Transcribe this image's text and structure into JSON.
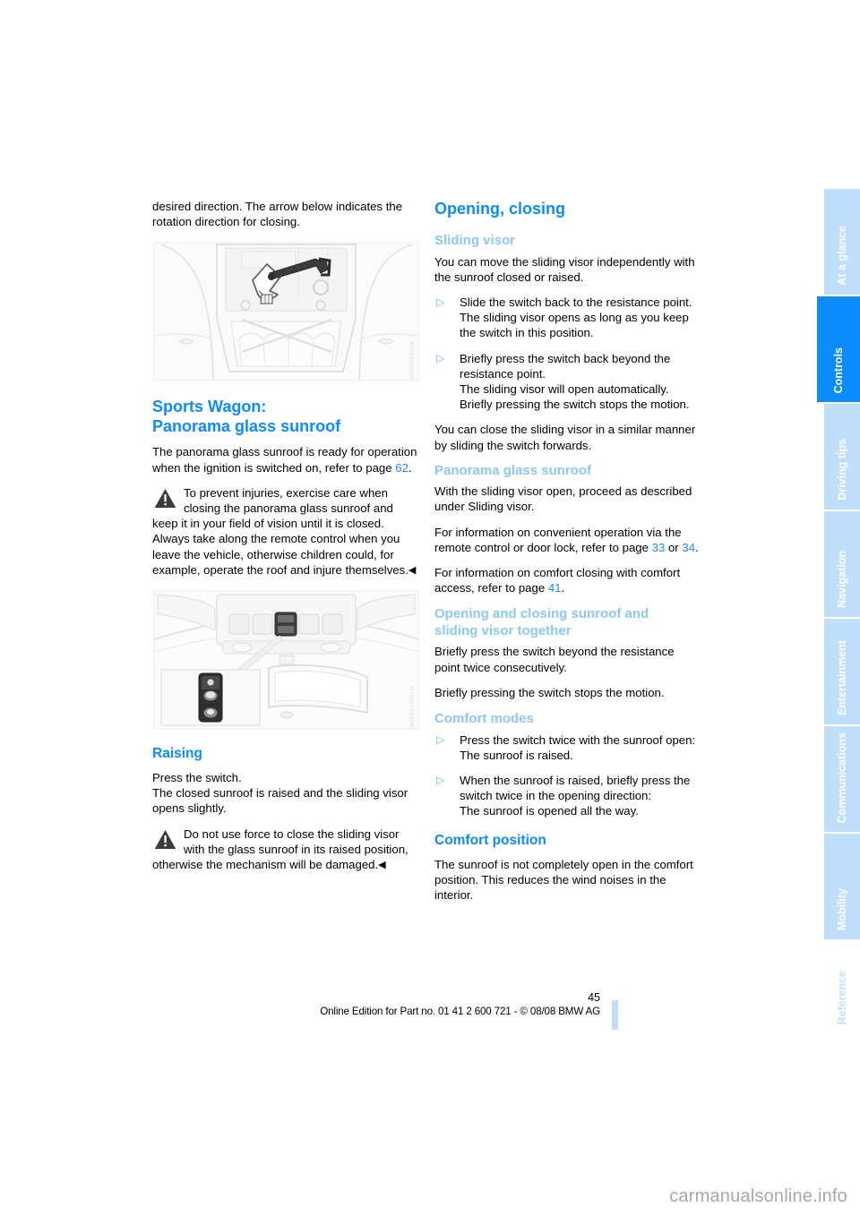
{
  "document": {
    "page_number": "45",
    "footer_line": "Online Edition for Part no. 01 41 2 600 721 - © 08/08 BMW AG",
    "watermark": "carmanualsonline.info"
  },
  "tabs": [
    {
      "label": "At a glance",
      "active": false
    },
    {
      "label": "Controls",
      "active": true
    },
    {
      "label": "Driving tips",
      "active": false
    },
    {
      "label": "Navigation",
      "active": false
    },
    {
      "label": "Entertainment",
      "active": false
    },
    {
      "label": "Communications",
      "active": false
    },
    {
      "label": "Mobility",
      "active": false
    },
    {
      "label": "Reference",
      "active": false
    }
  ],
  "colors": {
    "accent_blue": "#0b8bff",
    "light_blue": "#8cc8f5",
    "tab_blue": "#bfdffb",
    "link_blue": "#1b8bf9"
  },
  "left_column": {
    "intro_paragraph": "desired direction. The arrow below indicates the rotation direction for closing.",
    "figure_1": {
      "name": "sunroof-mechanism-illustration",
      "code": "WK05PE50UK"
    },
    "heading_line1": "Sports Wagon:",
    "heading_line2": "Panorama glass sunroof",
    "para_ready_a": "The panorama glass sunroof is ready for operation when the ignition is switched on, refer to page ",
    "para_ready_page": "62",
    "para_ready_b": ".",
    "warning_1": "To prevent injuries, exercise care when closing the panorama glass sunroof and keep it in your field of vision until it is closed. Always take along the remote control when you leave the vehicle, otherwise children could, for example, operate the roof and injure themselves.",
    "figure_2": {
      "name": "overhead-console-switch-illustration",
      "code": "WK05B10H1UK"
    },
    "raising_heading": "Raising",
    "raising_para": "Press the switch.\nThe closed sunroof is raised and the sliding visor opens slightly.",
    "warning_2": "Do not use force to close the sliding visor with the glass sunroof in its raised position, otherwise the mechanism will be damaged."
  },
  "right_column": {
    "h1_opening_closing": "Opening, closing",
    "h3_sliding_visor": "Sliding visor",
    "sliding_visor_para": "You can move the sliding visor independently with the sunroof closed or raised.",
    "bullet_1": "Slide the switch back to the resistance point.\nThe sliding visor opens as long as you keep the switch in this position.",
    "bullet_2": "Briefly press the switch back beyond the resistance point.\nThe sliding visor will open automatically. Briefly pressing the switch stops the motion.",
    "close_para": "You can close the sliding visor in a similar manner by sliding the switch forwards.",
    "h3_panorama": "Panorama glass sunroof",
    "panorama_para": "With the sliding visor open, proceed as described under Sliding visor.",
    "remote_a": "For information on convenient operation via the remote control or door lock, refer to page ",
    "remote_page_1": "33",
    "remote_mid": " or ",
    "remote_page_2": "34",
    "remote_b": ".",
    "comfort_access_a": "For information on comfort closing with comfort access, refer to page ",
    "comfort_access_page": "41",
    "comfort_access_b": ".",
    "h3_together_line1": "Opening and closing sunroof and",
    "h3_together_line2": "sliding visor together",
    "together_para_1": "Briefly press the switch beyond the resistance point twice consecutively.",
    "together_para_2": "Briefly pressing the switch stops the motion.",
    "h3_comfort_modes": "Comfort modes",
    "comfort_bullet_1": "Press the switch twice with the sunroof open:\nThe sunroof is raised.",
    "comfort_bullet_2": "When the sunroof is raised, briefly press the switch twice in the opening direction:\nThe sunroof is opened all the way.",
    "h2_comfort_position": "Comfort position",
    "comfort_position_para": "The sunroof is not completely open in the comfort position. This reduces the wind noises in the interior."
  },
  "icons": {
    "warning_triangle": "warning-triangle-icon",
    "bullet_marker": "triangle-right-bullet-icon",
    "end_mark": "section-end-marker"
  }
}
